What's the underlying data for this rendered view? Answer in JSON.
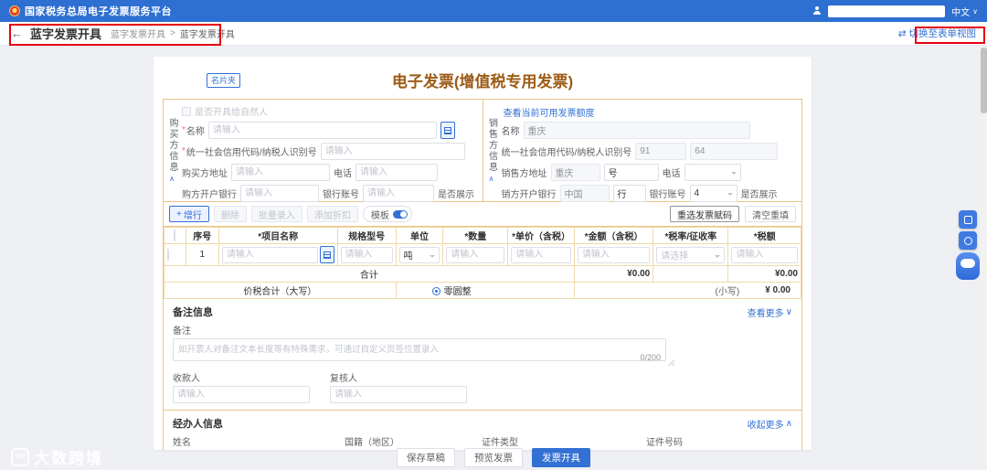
{
  "header": {
    "platform_title": "国家税务总局电子发票服务平台",
    "language": "中文"
  },
  "subheader": {
    "page_title": "蓝字发票开具",
    "breadcrumb": [
      "蓝字发票开具",
      "蓝字发票开具"
    ],
    "switch_view_label": "切换至表单视图"
  },
  "invoice": {
    "contact_tag": "名片夹",
    "title": "电子发票(增值税专用发票)",
    "buyer": {
      "section_label": "购买方信息",
      "natural_person_label": "是否开具给自然人",
      "name_label": "名称",
      "tax_id_label": "统一社会信用代码/纳税人识别号",
      "address_label": "购买方地址",
      "phone_label": "电话",
      "bank_label": "购方开户银行",
      "account_label": "银行账号",
      "show_label": "是否展示"
    },
    "seller": {
      "section_label": "销售方信息",
      "quota_link": "查看当前可用发票额度",
      "name_label": "名称",
      "name_value": "重庆",
      "tax_id_label": "统一社会信用代码/纳税人识别号",
      "tax_id_value1": "91",
      "tax_id_value2": "64",
      "address_label": "销售方地址",
      "address_value1": "重庆",
      "address_value2": "号",
      "phone_label": "电话",
      "bank_label": "销方开户银行",
      "bank_value1": "中国",
      "bank_value2": "行",
      "account_label": "银行账号",
      "account_value": "4",
      "show_label": "是否展示"
    },
    "toolbar": {
      "add_row": "增行",
      "delete": "删除",
      "batch_input": "批量录入",
      "add_discount": "添加折扣",
      "template": "模板",
      "reselect": "重选发票赋码",
      "clear": "清空重填"
    },
    "table": {
      "headers": [
        "序号",
        "*项目名称",
        "规格型号",
        "单位",
        "*数量",
        "*单价（含税）",
        "*金额（含税）",
        "*税率/征收率",
        "*税额"
      ],
      "row_index": "1",
      "unit_value": "吨",
      "total_label": "合计",
      "total_amount": "¥0.00",
      "total_tax": "¥0.00",
      "sum_label": "价税合计（大写）",
      "sum_words": "零圆整",
      "sum_small_label": "(小写)",
      "sum_value": "¥ 0.00"
    },
    "remarks": {
      "title": "备注信息",
      "more_link": "查看更多",
      "note_label": "备注",
      "note_placeholder": "如开票人对备注文本长度等有特殊需求，可通过自定义页签位置录入",
      "counter": "0/200",
      "payee_label": "收款人",
      "reviewer_label": "复核人"
    },
    "agent": {
      "title": "经办人信息",
      "collapse_link": "收起更多",
      "name_label": "姓名",
      "nationality_label": "国籍（地区）",
      "id_type_label": "证件类型",
      "id_number_label": "证件号码"
    }
  },
  "footer": {
    "save_draft": "保存草稿",
    "preview": "预览发票",
    "issue": "发票开具"
  },
  "watermark": {
    "logo": "100",
    "text": "大数跨境"
  },
  "misc": {
    "required_mark": "*",
    "breadcrumb_sep": ">",
    "back_arrow": "←",
    "swap_glyph": "⇄",
    "plus": "+",
    "caret_down": "∨",
    "caret_up": "∧",
    "ph_input": "请输入",
    "ph_select": "请选择"
  }
}
